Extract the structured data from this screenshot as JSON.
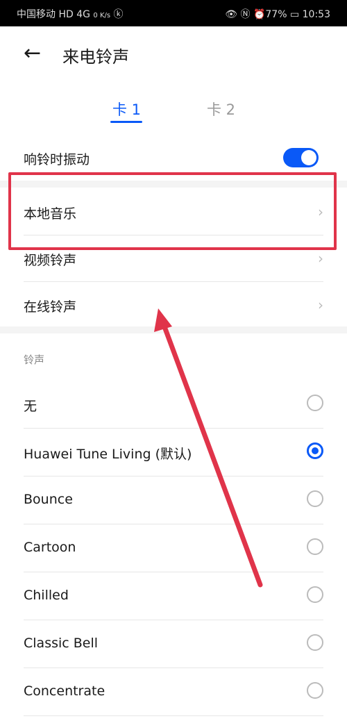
{
  "status_bar": {
    "carrier": "中国移动",
    "net": "HD 4G",
    "speed": "0 K/s",
    "battery": "77%",
    "time": "10:53"
  },
  "header": {
    "title": "来电铃声"
  },
  "tabs": [
    {
      "label": "卡 1",
      "active": true
    },
    {
      "label": "卡 2",
      "active": false
    }
  ],
  "vibrate": {
    "label": "响铃时振动",
    "on": true
  },
  "sources": [
    {
      "label": "本地音乐"
    },
    {
      "label": "视频铃声"
    },
    {
      "label": "在线铃声"
    }
  ],
  "ringtones": {
    "section_label": "铃声",
    "items": [
      {
        "label": "无",
        "selected": false
      },
      {
        "label": "Huawei Tune Living (默认)",
        "selected": true
      },
      {
        "label": "Bounce",
        "selected": false
      },
      {
        "label": "Cartoon",
        "selected": false
      },
      {
        "label": "Chilled",
        "selected": false
      },
      {
        "label": "Classic Bell",
        "selected": false
      },
      {
        "label": "Concentrate",
        "selected": false
      }
    ]
  },
  "colors": {
    "accent": "#0a59f7",
    "annotation": "#e0344a"
  }
}
